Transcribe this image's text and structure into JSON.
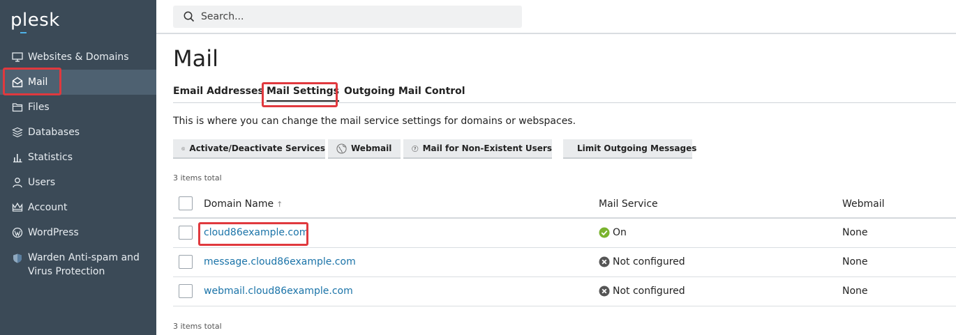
{
  "sidebar": {
    "logo": "plesk",
    "items": [
      {
        "label": "Websites & Domains",
        "icon": "monitor-icon"
      },
      {
        "label": "Mail",
        "icon": "mail-icon"
      },
      {
        "label": "Files",
        "icon": "folder-icon"
      },
      {
        "label": "Databases",
        "icon": "database-icon"
      },
      {
        "label": "Statistics",
        "icon": "bar-chart-icon"
      },
      {
        "label": "Users",
        "icon": "user-icon"
      },
      {
        "label": "Account",
        "icon": "crown-icon"
      },
      {
        "label": "WordPress",
        "icon": "wordpress-icon"
      },
      {
        "label": "Warden Anti-spam and Virus Protection",
        "icon": "shield-icon"
      }
    ]
  },
  "search": {
    "placeholder": "Search..."
  },
  "page": {
    "title": "Mail",
    "tabs": [
      "Email Addresses",
      "Mail Settings",
      "Outgoing Mail Control"
    ],
    "description": "This is where you can change the mail service settings for domains or webspaces."
  },
  "toolbar": {
    "buttons": [
      {
        "label": "Activate/Deactivate Services",
        "icon": "power-icon"
      },
      {
        "label": "Webmail",
        "icon": "globe-icon"
      },
      {
        "label": "Mail for Non-Existent Users",
        "icon": "question-icon"
      },
      {
        "label": "Limit Outgoing Messages"
      }
    ]
  },
  "table": {
    "count_top": "3 items total",
    "count_bottom": "3 items total",
    "columns": {
      "domain": "Domain Name",
      "domain_sort": "↑",
      "mail": "Mail Service",
      "webmail": "Webmail"
    },
    "rows": [
      {
        "domain": "cloud86example.com",
        "mail_service": "On",
        "status": "on",
        "webmail": "None"
      },
      {
        "domain": "message.cloud86example.com",
        "mail_service": "Not configured",
        "status": "off",
        "webmail": "None"
      },
      {
        "domain": "webmail.cloud86example.com",
        "mail_service": "Not configured",
        "status": "off",
        "webmail": "None"
      }
    ]
  },
  "colors": {
    "sidebar_bg": "#3b4a57",
    "sidebar_active": "#4e6171",
    "link": "#1a73a8",
    "highlight": "#e0393e",
    "status_on": "#7ab32e",
    "status_off": "#555555"
  }
}
